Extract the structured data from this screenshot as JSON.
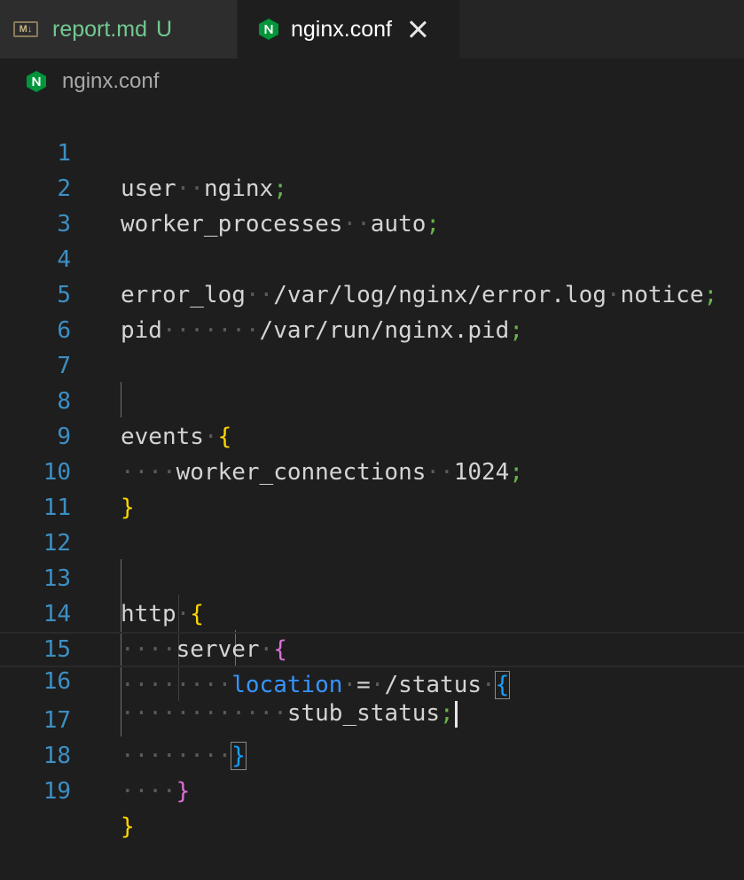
{
  "tabs": [
    {
      "icon": "markdown-icon",
      "icon_text": "M↓",
      "label": "report.md",
      "status": "U",
      "active": false
    },
    {
      "icon": "nginx-icon",
      "label": "nginx.conf",
      "active": true
    }
  ],
  "breadcrumb": {
    "label": "nginx.conf"
  },
  "editor": {
    "line_numbers": [
      "1",
      "2",
      "3",
      "4",
      "5",
      "6",
      "7",
      "8",
      "9",
      "10",
      "11",
      "12",
      "13",
      "14",
      "15",
      "16",
      "17",
      "18",
      "19"
    ],
    "cursor_line": 16
  },
  "colors": {
    "background": "#1e1e1e",
    "line_number": "#3c8fc4",
    "semicolon": "#66b34a",
    "bracket_level1": "#ffd700",
    "bracket_level2": "#da70d6",
    "bracket_level3": "#179fff",
    "keyword_location": "#3794ff",
    "modified_tab_text": "#73c991"
  },
  "code": {
    "l1": {
      "t1": "user",
      "ws": "··",
      "t2": "nginx",
      "semi": ";"
    },
    "l2": {
      "t1": "worker_processes",
      "ws": "··",
      "t2": "auto",
      "semi": ";"
    },
    "l4": {
      "t1": "error_log",
      "ws1": "··",
      "t2": "/var/log/nginx/error.log",
      "ws2": "·",
      "t3": "notice",
      "semi": ";"
    },
    "l5": {
      "t1": "pid",
      "ws": "·······",
      "t2": "/var/run/nginx.pid",
      "semi": ";"
    },
    "l8": {
      "t1": "events",
      "ws": "·",
      "brace": "{"
    },
    "l9": {
      "ws": "····",
      "t1": "worker_connections",
      "ws2": "··",
      "t2": "1024",
      "semi": ";"
    },
    "l10": {
      "brace": "}"
    },
    "l13": {
      "t1": "http",
      "ws": "·",
      "brace": "{"
    },
    "l14": {
      "ws": "····",
      "t1": "server",
      "ws2": "·",
      "brace": "{"
    },
    "l15": {
      "ws": "········",
      "kw": "location",
      "ws2": "·",
      "op": "=",
      "ws3": "·",
      "t2": "/status",
      "ws4": "·",
      "brace": "{"
    },
    "l16": {
      "ws": "············",
      "t1": "stub_status",
      "semi": ";"
    },
    "l17": {
      "ws": "········",
      "brace": "}"
    },
    "l18": {
      "ws": "····",
      "brace": "}"
    },
    "l19": {
      "brace": "}"
    }
  }
}
